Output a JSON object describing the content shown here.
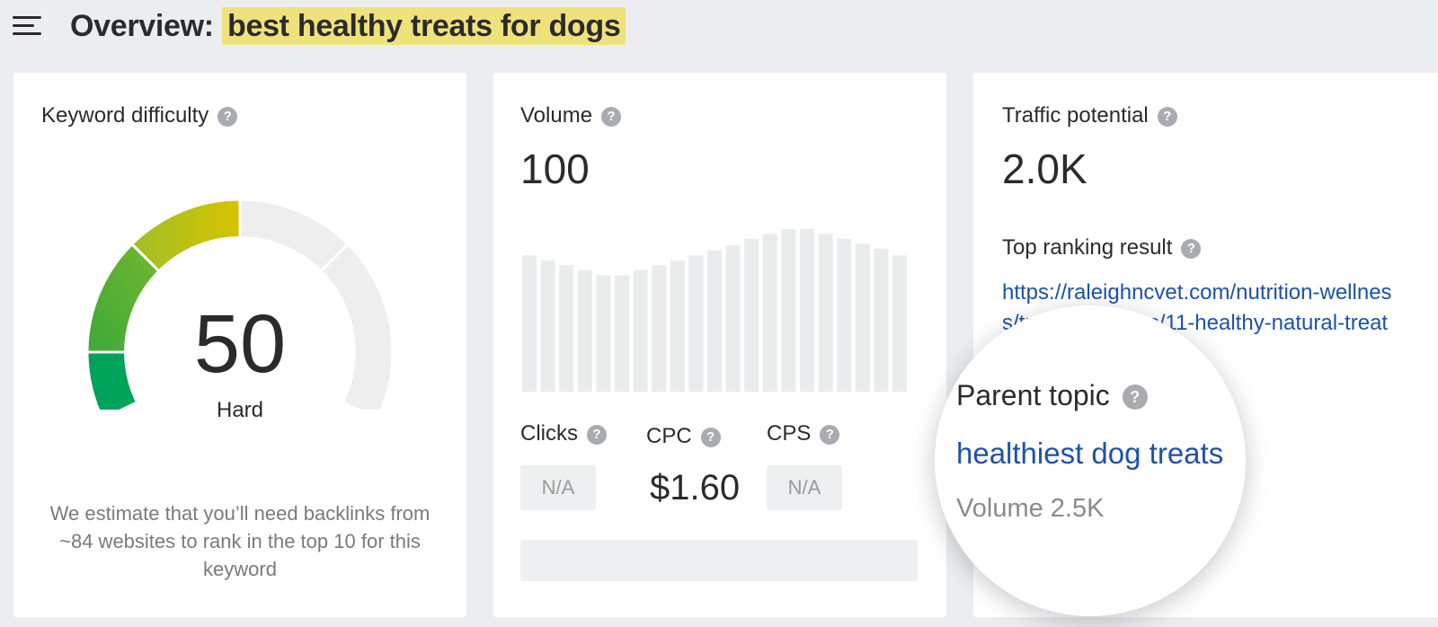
{
  "header": {
    "title_prefix": "Overview:",
    "keyword": "best healthy treats for dogs",
    "menu_icon": "hamburger-menu-icon"
  },
  "keyword_difficulty": {
    "label": "Keyword difficulty",
    "value": "50",
    "value_fraction": 0.5,
    "level": "Hard",
    "description": "We estimate that you’ll need backlinks from ~84 websites to rank in the top 10 for this keyword",
    "colors": {
      "green_dark": "#00a35a",
      "green": "#55b035",
      "olive": "#9fbf26",
      "yellow": "#d7c300",
      "empty": "#eeeeef"
    }
  },
  "volume": {
    "label": "Volume",
    "value": "100",
    "trend": [
      0.82,
      0.79,
      0.76,
      0.73,
      0.7,
      0.7,
      0.73,
      0.76,
      0.79,
      0.82,
      0.85,
      0.88,
      0.92,
      0.95,
      0.98,
      0.98,
      0.95,
      0.92,
      0.89,
      0.86,
      0.82
    ],
    "clicks": {
      "label": "Clicks",
      "value": "N/A"
    },
    "cpc": {
      "label": "CPC",
      "value": "$1.60"
    },
    "cps": {
      "label": "CPS",
      "value": "N/A"
    }
  },
  "traffic_potential": {
    "label": "Traffic potential",
    "value": "2.0K",
    "top_ranking_label": "Top ranking result",
    "top_ranking_url": "https://raleighncvet.com/nutrition-wellness/treats-for-dogs/11-healthy-natural-treats-in-your-kitchen/"
  },
  "parent_topic": {
    "label": "Parent topic",
    "topic": "healthiest dog treats",
    "volume": "Volume 2.5K"
  },
  "help_icon_glyph": "?"
}
